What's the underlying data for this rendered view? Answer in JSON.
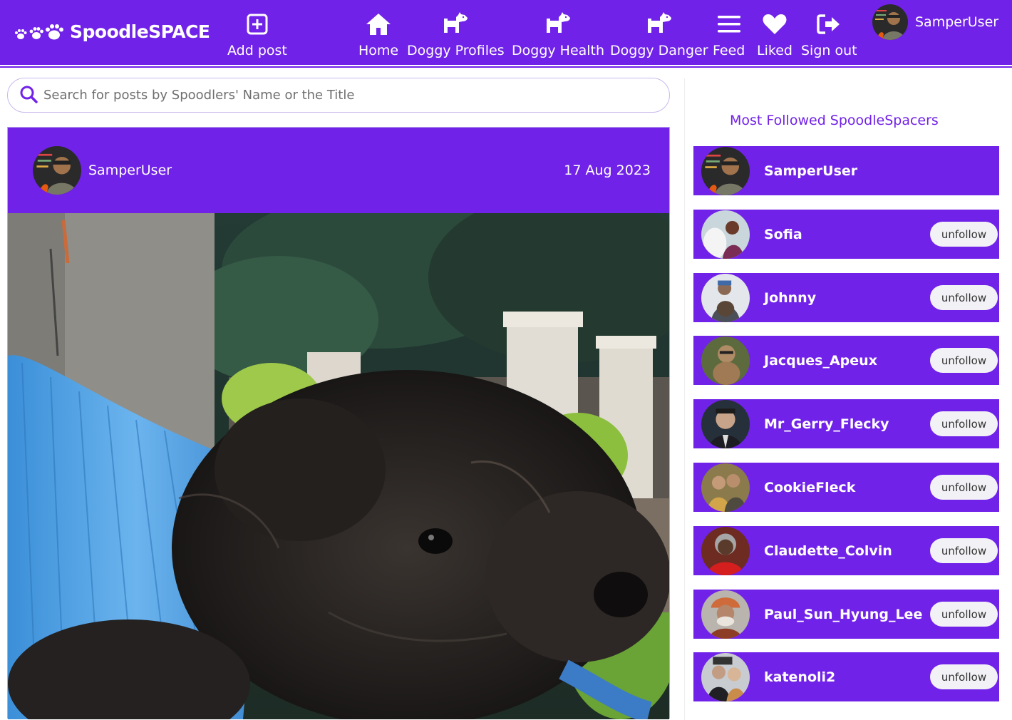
{
  "brand": {
    "name": "SpoodleSPACE"
  },
  "nav": {
    "add_post": "Add post",
    "home": "Home",
    "doggy_profiles": "Doggy Profiles",
    "doggy_health": "Doggy Health",
    "doggy_danger": "Doggy Danger",
    "feed": "Feed",
    "liked": "Liked",
    "sign_out": "Sign out",
    "user": "SamperUser"
  },
  "search": {
    "placeholder": "Search for posts by Spoodlers' Name or the Title"
  },
  "post": {
    "author": "SamperUser",
    "date": "17 Aug 2023"
  },
  "sidebar": {
    "title": "Most Followed SpoodleSpacers",
    "profiles": [
      {
        "name": "SamperUser",
        "button": ""
      },
      {
        "name": "Sofia",
        "button": "unfollow"
      },
      {
        "name": "Johnny",
        "button": "unfollow"
      },
      {
        "name": "Jacques_Apeux",
        "button": "unfollow"
      },
      {
        "name": "Mr_Gerry_Flecky",
        "button": "unfollow"
      },
      {
        "name": "CookieFleck",
        "button": "unfollow"
      },
      {
        "name": "Claudette_Colvin",
        "button": "unfollow"
      },
      {
        "name": "Paul_Sun_Hyung_Lee",
        "button": "unfollow"
      },
      {
        "name": "katenoli2",
        "button": "unfollow"
      }
    ]
  },
  "colors": {
    "primary": "#7122e8",
    "white": "#ffffff"
  },
  "icons": [
    "paw-icon",
    "plus-square-icon",
    "house-icon",
    "dog-icon",
    "bars-icon",
    "heart-icon",
    "sign-out-icon",
    "search-icon"
  ]
}
